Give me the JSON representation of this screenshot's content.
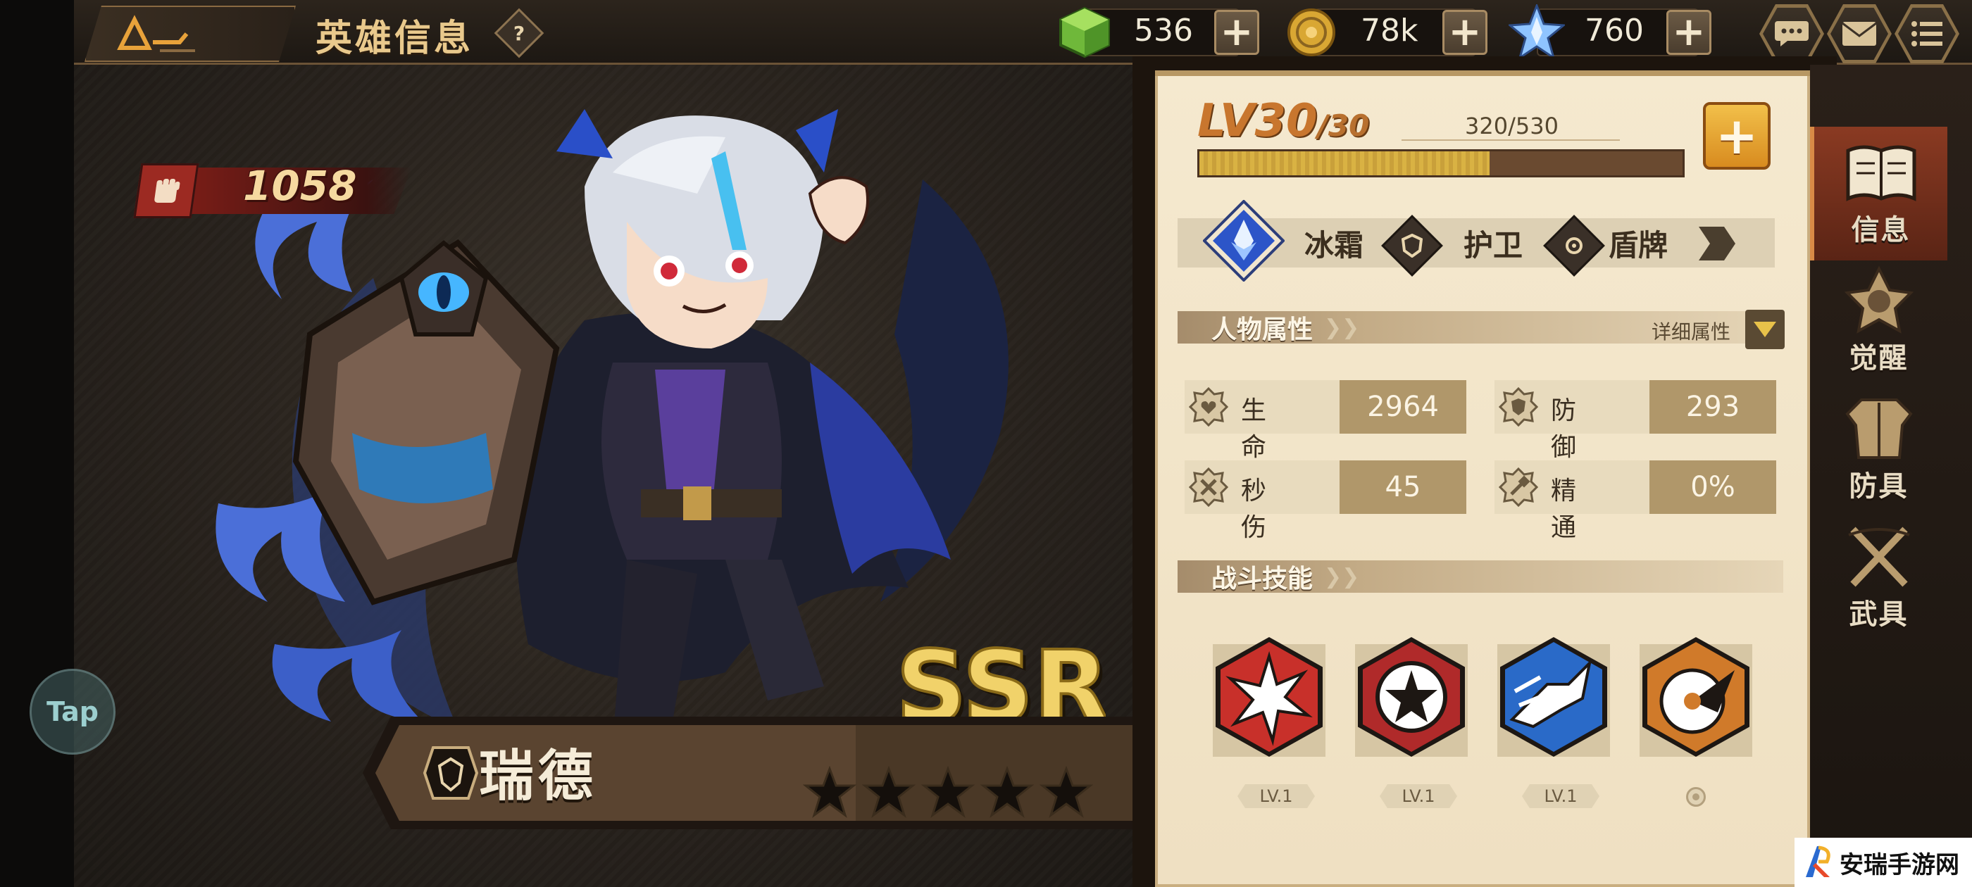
{
  "header": {
    "title": "英雄信息",
    "help_icon": "question-mark",
    "currencies": [
      {
        "name": "green-cube-gem",
        "value": "536",
        "color": "#7cc242"
      },
      {
        "name": "gold-coin",
        "value": "78k",
        "color": "#d9a733"
      },
      {
        "name": "crystal-star",
        "value": "760",
        "color": "#7fb8ff"
      }
    ],
    "right_icons": [
      "chat-icon",
      "mail-icon",
      "menu-icon"
    ]
  },
  "hero": {
    "power": "1058",
    "name": "瑞德",
    "rarity": "SSR",
    "stars": 5,
    "tap_label": "Tap"
  },
  "level": {
    "current": "LV30",
    "max": "/30",
    "exp_text": "320/530",
    "exp_fraction": 0.6
  },
  "tags": [
    {
      "label": "冰霜",
      "icon": "ice-crystal-icon"
    },
    {
      "label": "护卫",
      "icon": "shield-class-icon"
    },
    {
      "label": "盾牌",
      "icon": "shield-ring-icon"
    }
  ],
  "attributes": {
    "title": "人物属性",
    "detail_label": "详细属性",
    "stats": [
      {
        "label": "生命",
        "value": "2964",
        "icon": "heart-gear-icon"
      },
      {
        "label": "防御",
        "value": "293",
        "icon": "shield-gear-icon"
      },
      {
        "label": "秒伤",
        "value": "45",
        "icon": "swords-gear-icon"
      },
      {
        "label": "精通",
        "value": "0%",
        "icon": "hammer-gear-icon"
      }
    ]
  },
  "skills": {
    "title": "战斗技能",
    "items": [
      {
        "level": "LV.1",
        "icon": "explosion-skill-icon",
        "color": "#c8302a"
      },
      {
        "level": "LV.1",
        "icon": "star-shield-skill-icon",
        "color": "#b02a2a"
      },
      {
        "level": "LV.1",
        "icon": "dash-skill-icon",
        "color": "#2a6ac8"
      },
      {
        "level": "",
        "icon": "drill-skill-icon",
        "color": "#d07a2a"
      }
    ]
  },
  "side_tabs": [
    {
      "label": "信息",
      "icon": "book-icon",
      "active": true
    },
    {
      "label": "觉醒",
      "icon": "awaken-emblem-icon",
      "active": false
    },
    {
      "label": "防具",
      "icon": "armor-icon",
      "active": false
    },
    {
      "label": "武具",
      "icon": "weapon-icon",
      "active": false
    }
  ],
  "watermark": {
    "text": "安瑞手游网"
  }
}
